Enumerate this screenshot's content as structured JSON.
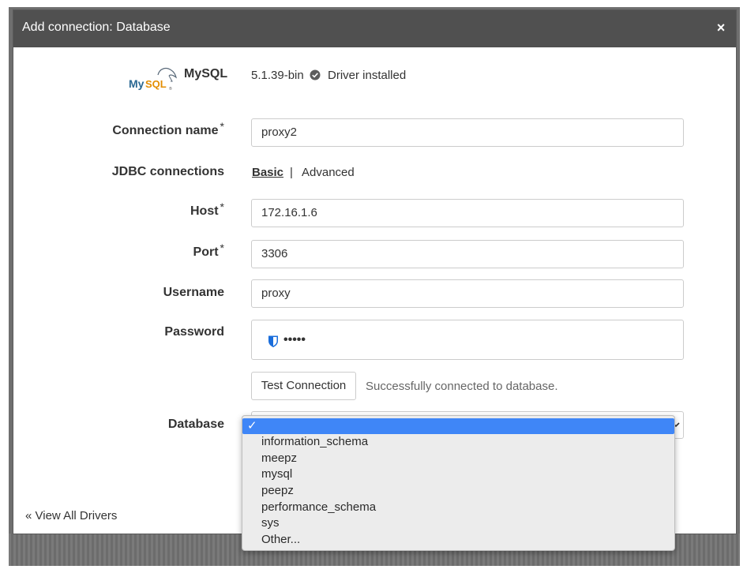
{
  "dialog": {
    "title": "Add connection: Database",
    "close_glyph": "×"
  },
  "driver": {
    "logo": "mysql-logo",
    "name": "MySQL",
    "version": "5.1.39-bin",
    "status": "Driver installed"
  },
  "form": {
    "connection_name": {
      "label": "Connection name",
      "required": "*",
      "value": "proxy2"
    },
    "jdbc": {
      "label": "JDBC connections",
      "basic": "Basic",
      "separator": "|",
      "advanced": "Advanced"
    },
    "host": {
      "label": "Host",
      "required": "*",
      "value": "172.16.1.6"
    },
    "port": {
      "label": "Port",
      "required": "*",
      "value": "3306"
    },
    "username": {
      "label": "Username",
      "value": "proxy"
    },
    "password": {
      "label": "Password",
      "masked_value": "•••••"
    },
    "test": {
      "button": "Test Connection",
      "status": "Successfully connected to database."
    },
    "database": {
      "label": "Database",
      "selected_mark": "✓",
      "options": [
        "information_schema",
        "meepz",
        "mysql",
        "peepz",
        "performance_schema",
        "sys",
        "Other..."
      ]
    }
  },
  "footer": {
    "view_all": "View All Drivers",
    "view_all_glyph": "«"
  },
  "colors": {
    "header_bg": "#505050",
    "highlight": "#3f86f7",
    "check": "#555555"
  }
}
